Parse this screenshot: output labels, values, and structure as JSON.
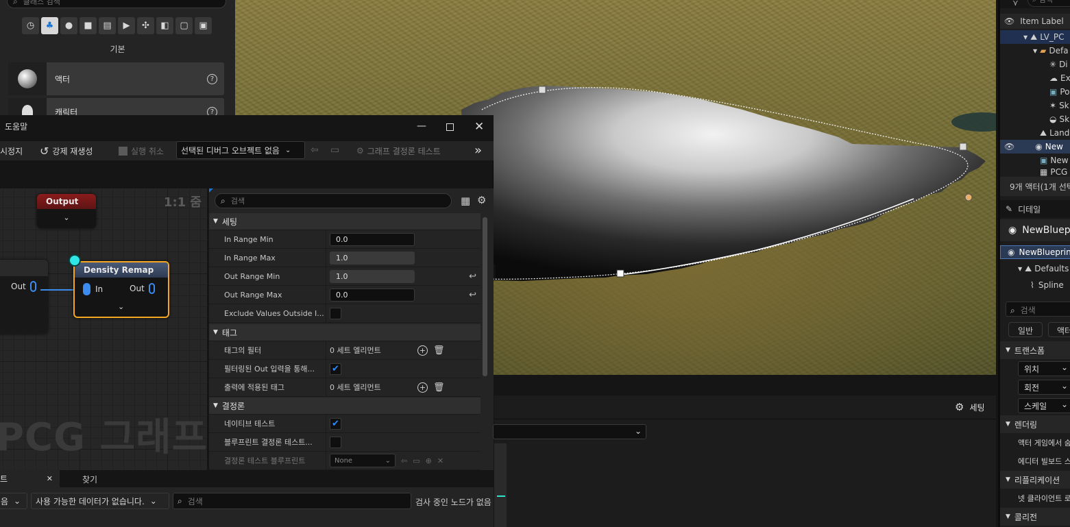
{
  "place_actors": {
    "search_placeholder": "클래스 검색",
    "category_label": "기본",
    "items": [
      {
        "label": "액터"
      },
      {
        "label": "캐릭터"
      }
    ]
  },
  "pcg_window": {
    "menu_help": "도움말",
    "toolbar": {
      "stop_label": "시정지",
      "force_regen_label": "강제 재생성",
      "cancel_exec_label": "실행 취소",
      "debug_object_label": "선택된 디버그 오브젝트 없음",
      "determinism_label": "그래프 결정론 테스트"
    },
    "graph": {
      "zoom_label": "1:1 줌",
      "watermark": "PCG 그래프",
      "output_node_title": "Output",
      "left_node_out": "Out",
      "remap_node_title": "Density Remap",
      "remap_in": "In",
      "remap_out": "Out"
    },
    "details": {
      "search_placeholder": "검색",
      "section_settings": "세팅",
      "in_range_min_label": "In Range Min",
      "in_range_min": "0.0",
      "in_range_max_label": "In Range Max",
      "in_range_max": "1.0",
      "out_range_min_label": "Out Range Min",
      "out_range_min": "1.0",
      "out_range_max_label": "Out Range Max",
      "out_range_max": "0.0",
      "exclude_label": "Exclude Values Outside I...",
      "section_tags": "태그",
      "tag_filter_label": "태그의 필터",
      "tag_filter_value": "0 세트 엘리먼트",
      "filtered_out_label": "필터링된 Out 입력을 통해...",
      "output_tags_label": "출력에 적용된 태그",
      "output_tags_value": "0 세트 엘리먼트",
      "section_determinism": "결정론",
      "native_test_label": "네이티브 테스트",
      "bp_test_label": "블루프린트 결정론 테스트...",
      "bp_test_bp_label": "결정론 테스트 블루프린트",
      "bp_test_bp_value": "None"
    },
    "bottom": {
      "tab_log": "트",
      "tab_find": "찾기",
      "dd_left": "음",
      "dd_data": "사용 가능한 데이터가 없습니다.",
      "search_placeholder": "검색",
      "inspect_status": "검사 중인 노드가 없음"
    }
  },
  "viewport_bottom": {
    "settings_label": "세팅"
  },
  "outliner": {
    "search_placeholder": "검색",
    "column_label": "Item Label",
    "rows": [
      {
        "label": "LV_PC"
      },
      {
        "label": "Defa"
      },
      {
        "label": "Di"
      },
      {
        "label": "Ex"
      },
      {
        "label": "Po"
      },
      {
        "label": "Sk"
      },
      {
        "label": "Sk"
      },
      {
        "label": "Land"
      },
      {
        "label": "New"
      },
      {
        "label": "New"
      },
      {
        "label": "PCG"
      }
    ],
    "status": "9개 액터(1개 선택"
  },
  "details_right": {
    "tab_label": "디테일",
    "actor_name": "NewBluep",
    "component_root": "NewBlueprin",
    "component_default": "Defaults",
    "component_spline": "Spline",
    "search_placeholder": "검색",
    "filter_general": "일반",
    "filter_actor": "액터",
    "section_transform": "트랜스폼",
    "location": "위치",
    "rotation": "회전",
    "scale": "스케일",
    "section_rendering": "렌더링",
    "render_row1": "액터 게임에서 숨",
    "render_row2": "에디터 빌보드 스",
    "section_replication": "리플리케이션",
    "repl_row1": "넷 클라이언트 로",
    "section_collision": "콜리전"
  }
}
